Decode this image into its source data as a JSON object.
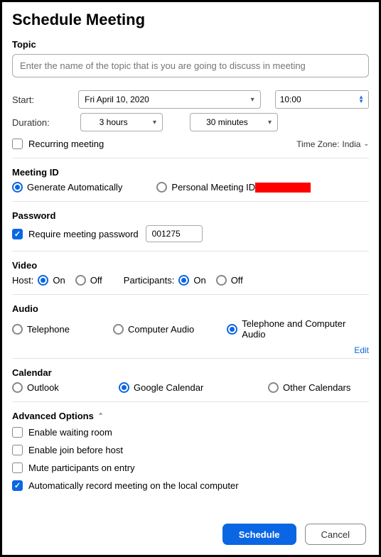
{
  "title": "Schedule Meeting",
  "topic": {
    "label": "Topic",
    "placeholder": "Enter the name of the topic that is you are going to discuss in meeting"
  },
  "start": {
    "label": "Start:",
    "date": "Fri  April 10, 2020",
    "time": "10:00"
  },
  "duration": {
    "label": "Duration:",
    "hours": "3 hours",
    "minutes": "30 minutes"
  },
  "recurring": {
    "label": "Recurring meeting",
    "checked": false
  },
  "timezone": {
    "prefix": "Time Zone:",
    "value": "India"
  },
  "meeting_id": {
    "label": "Meeting ID",
    "auto": "Generate Automatically",
    "personal": "Personal Meeting ID"
  },
  "password": {
    "label": "Password",
    "require": "Require meeting password",
    "value": "001275"
  },
  "video": {
    "label": "Video",
    "host": "Host:",
    "participants": "Participants:",
    "on": "On",
    "off": "Off"
  },
  "audio": {
    "label": "Audio",
    "telephone": "Telephone",
    "computer": "Computer Audio",
    "both": "Telephone and Computer Audio",
    "edit": "Edit"
  },
  "calendar": {
    "label": "Calendar",
    "outlook": "Outlook",
    "google": "Google Calendar",
    "other": "Other Calendars"
  },
  "advanced": {
    "label": "Advanced Options",
    "waiting": "Enable waiting room",
    "join_before": "Enable join before host",
    "mute": "Mute participants on entry",
    "record": "Automatically record meeting on the local computer"
  },
  "buttons": {
    "schedule": "Schedule",
    "cancel": "Cancel"
  }
}
